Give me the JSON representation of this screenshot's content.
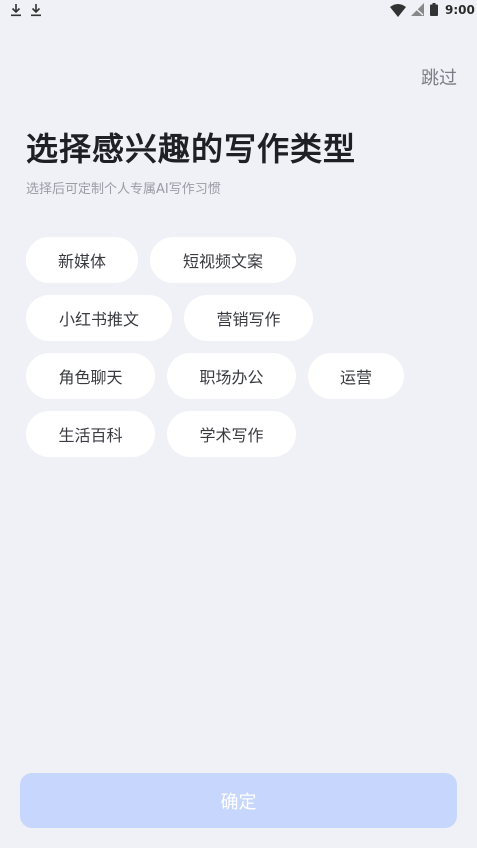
{
  "status_bar": {
    "time": "9:00",
    "icons": [
      "download-icon",
      "download-icon",
      "wifi-icon",
      "no-signal-icon",
      "battery-icon"
    ]
  },
  "header": {
    "skip_label": "跳过"
  },
  "main": {
    "title": "选择感兴趣的写作类型",
    "subtitle": "选择后可定制个人专属AI写作习惯",
    "tags": [
      {
        "label": "新媒体"
      },
      {
        "label": "短视频文案"
      },
      {
        "label": "小红书推文"
      },
      {
        "label": "营销写作"
      },
      {
        "label": "角色聊天"
      },
      {
        "label": "职场办公"
      },
      {
        "label": "运营"
      },
      {
        "label": "生活百科"
      },
      {
        "label": "学术写作"
      }
    ]
  },
  "footer": {
    "confirm_label": "确定"
  },
  "colors": {
    "background": "#f0f1f7",
    "chip_bg": "#ffffff",
    "confirm_bg_disabled": "#c7d6fc",
    "confirm_text": "#ffffff"
  }
}
